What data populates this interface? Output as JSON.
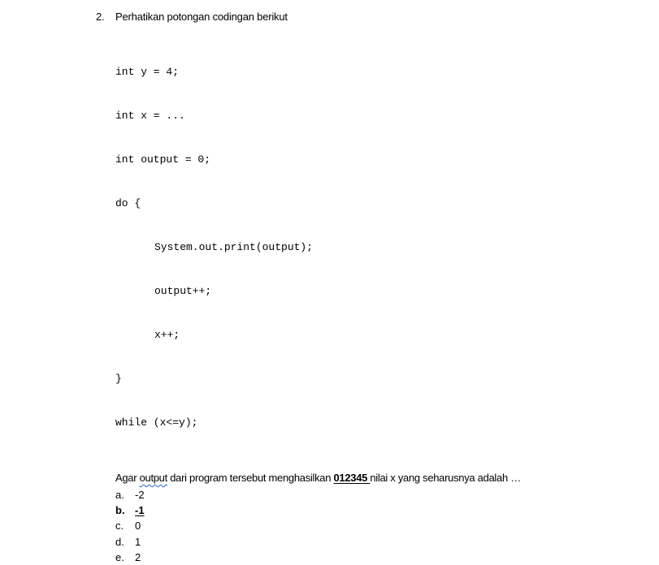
{
  "question": {
    "number": "2.",
    "heading": "Perhatikan potongan codingan berikut",
    "code_lines": [
      "int y = 4;",
      "int x = ...",
      "int output = 0;",
      "do {",
      "System.out.print(output);",
      "output++;",
      "x++;",
      "}",
      "while (x<=y);"
    ],
    "prompt": {
      "part1": "Agar ",
      "squiggle_word": "output",
      "part2": " dari program tersebut menghasilkan ",
      "highlight": "012345 ",
      "part3": " nilai x yang seharusnya adalah …"
    },
    "options": [
      {
        "letter": "a.",
        "text": "-2"
      },
      {
        "letter": "b.",
        "text": "-1"
      },
      {
        "letter": "c.",
        "text": "0"
      },
      {
        "letter": "d.",
        "text": "1"
      },
      {
        "letter": "e.",
        "text": "2"
      }
    ]
  }
}
